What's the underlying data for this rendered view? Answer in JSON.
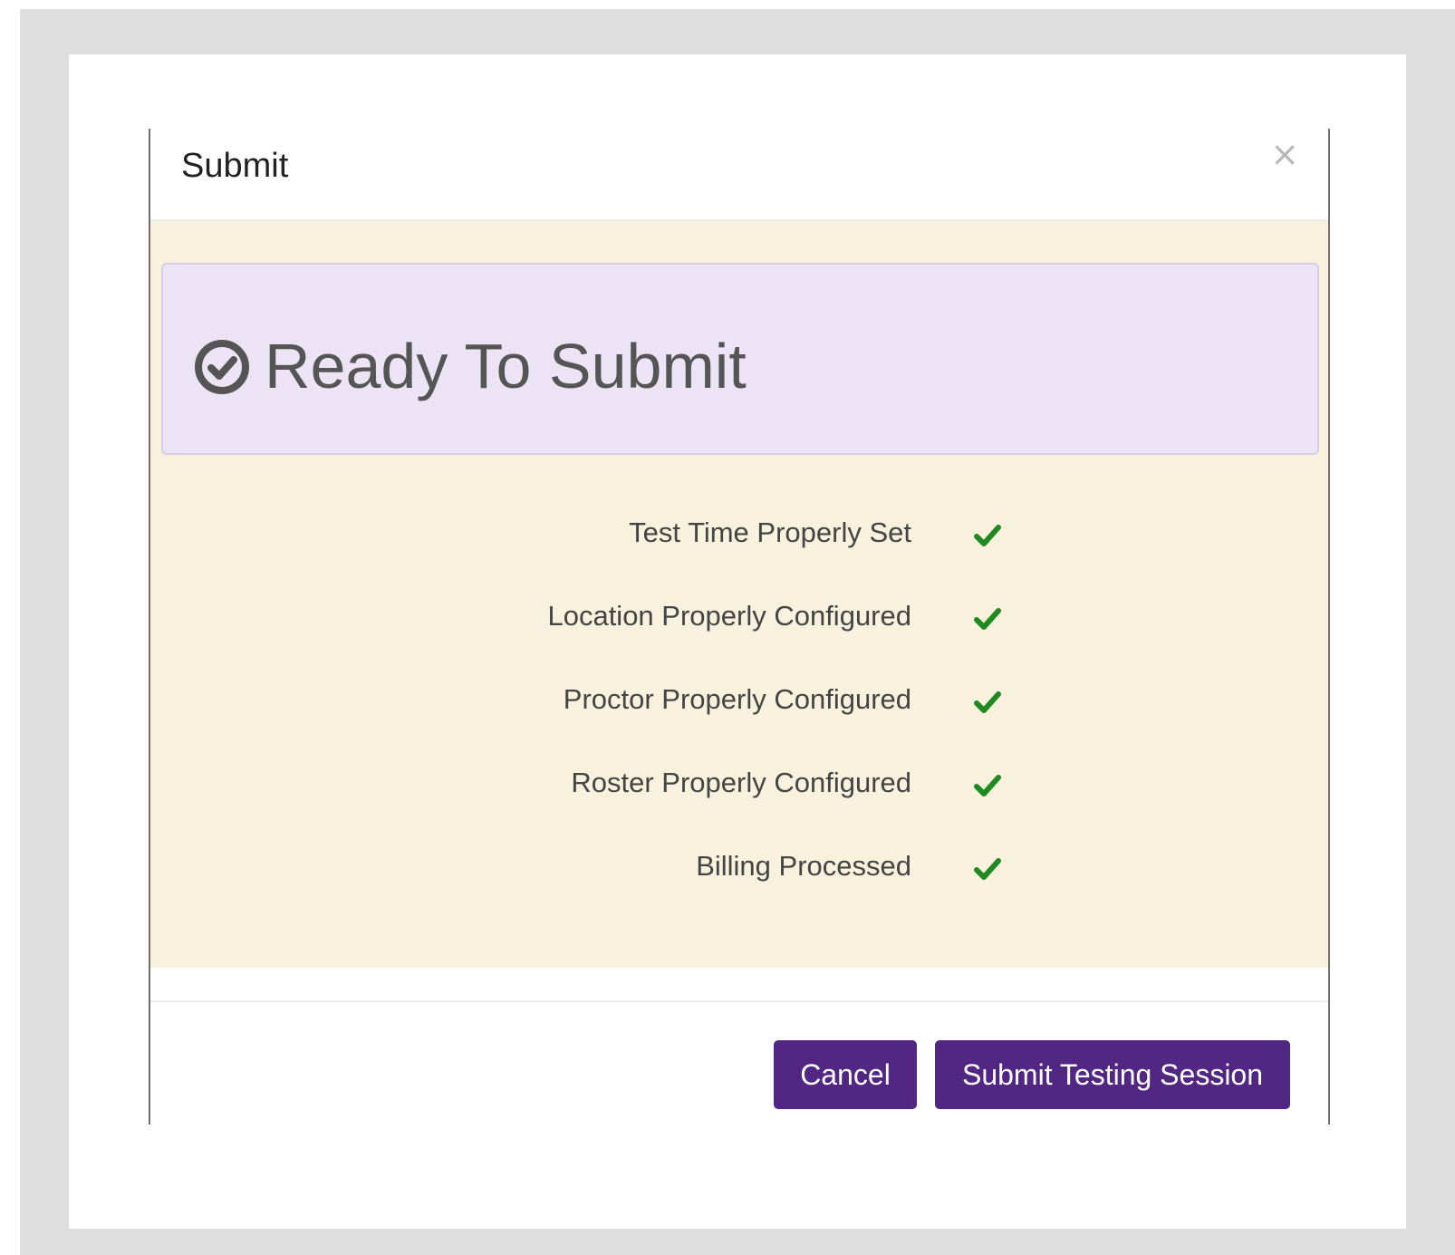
{
  "modal": {
    "title": "Submit",
    "close_label": "×"
  },
  "status": {
    "icon": "check-circle-icon",
    "title": "Ready To Submit"
  },
  "checklist": [
    {
      "label": "Test Time Properly Set",
      "status": "passed"
    },
    {
      "label": "Location Properly Configured",
      "status": "passed"
    },
    {
      "label": "Proctor Properly Configured",
      "status": "passed"
    },
    {
      "label": "Roster Properly Configured",
      "status": "passed"
    },
    {
      "label": "Billing Processed",
      "status": "passed"
    }
  ],
  "footer": {
    "cancel_label": "Cancel",
    "submit_label": "Submit Testing Session"
  },
  "colors": {
    "accent": "#522783",
    "check": "#1f8a1f",
    "body_background": "#f8f1dd",
    "panel_background": "#ece3f5"
  }
}
